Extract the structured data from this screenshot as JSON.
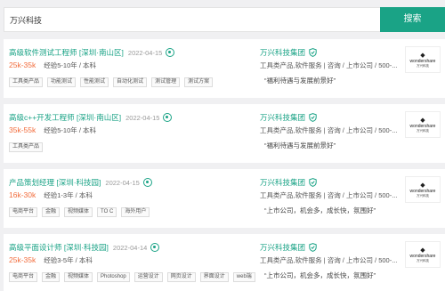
{
  "search": {
    "query": "万兴科技",
    "button_label": "搜索"
  },
  "jobs": [
    {
      "title": "高级软件测试工程师 [深圳·南山区]",
      "date": "2022-04-15",
      "salary": "25k-35k",
      "experience": "经验5-10年 / 本科",
      "tags": [
        "工具类产品",
        "功能测试",
        "性能测试",
        "自动化测试",
        "测试管理",
        "测试方案"
      ],
      "company": "万兴科技集团",
      "company_meta": "工具类产品,软件服务 | 咨询 / 上市公司 / 500-...",
      "quote": "“福利待遇与发展前景好”",
      "logo": {
        "mark": "◆",
        "name": "wondershare",
        "sub": "万兴科技"
      }
    },
    {
      "title": "高级c++开发工程师 [深圳·南山区]",
      "date": "2022-04-15",
      "salary": "35k-55k",
      "experience": "经验5-10年 / 本科",
      "tags": [
        "工具类产品"
      ],
      "company": "万兴科技集团",
      "company_meta": "工具类产品,软件服务 | 咨询 / 上市公司 / 500-...",
      "quote": "“福利待遇与发展前景好”",
      "logo": {
        "mark": "◆",
        "name": "wondershare",
        "sub": "万兴科技"
      }
    },
    {
      "title": "产品策划经理 [深圳·科技园]",
      "date": "2022-04-15",
      "salary": "16k-30k",
      "experience": "经验1-3年 / 本科",
      "tags": [
        "电商平台",
        "金融",
        "视频媒体",
        "TO C",
        "海外用户"
      ],
      "company": "万兴科技集团",
      "company_meta": "工具类产品,软件服务 | 咨询 / 上市公司 / 500-...",
      "quote": "“上市公司，机会多，成长快，氛围好”",
      "logo": {
        "mark": "◆",
        "name": "wondershare",
        "sub": "万兴科技"
      }
    },
    {
      "title": "高级平面设计师 [深圳·科技园]",
      "date": "2022-04-14",
      "salary": "25k-35k",
      "experience": "经验3-5年 / 本科",
      "tags": [
        "电商平台",
        "金融",
        "视频媒体",
        "Photoshop",
        "运营设计",
        "网页设计",
        "界面设计",
        "web端"
      ],
      "company": "万兴科技集团",
      "company_meta": "工具类产品,软件服务 | 咨询 / 上市公司 / 500-...",
      "quote": "“上市公司，机会多，成长快，氛围好”",
      "logo": {
        "mark": "◆",
        "name": "wondershare",
        "sub": "万兴科技"
      }
    }
  ],
  "colors": {
    "accent": "#1aa386",
    "salary": "#f26d3d",
    "background": "#f0f0f2"
  }
}
